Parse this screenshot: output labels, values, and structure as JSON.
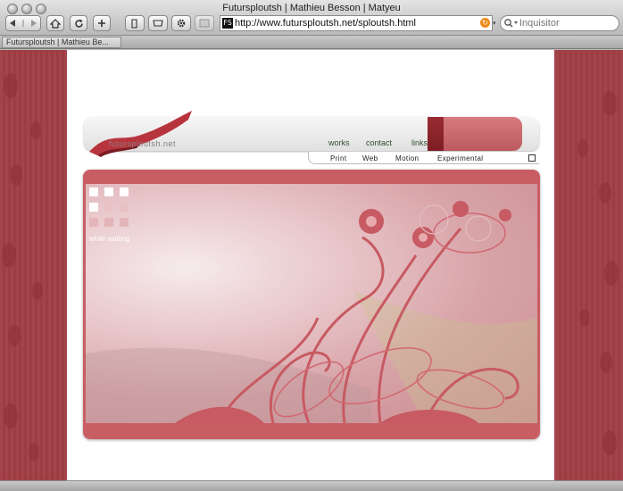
{
  "window": {
    "title": "Futursploutsh | Mathieu Besson | Matyeu"
  },
  "toolbar": {
    "back_icon": "back-arrow-icon",
    "forward_icon": "forward-arrow-icon",
    "home_icon": "home-icon",
    "reload_icon": "reload-icon",
    "add_icon": "plus-icon"
  },
  "address": {
    "favicon_text": "FS",
    "url": "http://www.futursploutsh.net/sploutsh.html"
  },
  "search": {
    "placeholder": "Inquisitor"
  },
  "tab": {
    "label": "Futursploutsh | Mathieu Be..."
  },
  "site": {
    "logo": "futursploutsh.net",
    "nav": [
      "works",
      "contact",
      "links"
    ],
    "subnav": [
      "Print",
      "Web",
      "Motion",
      "Experimental"
    ],
    "loading_text": "while waiting"
  },
  "colors": {
    "brand_red": "#c85e64",
    "side_red": "#a6454b",
    "nav_green": "#2f4f2f"
  }
}
